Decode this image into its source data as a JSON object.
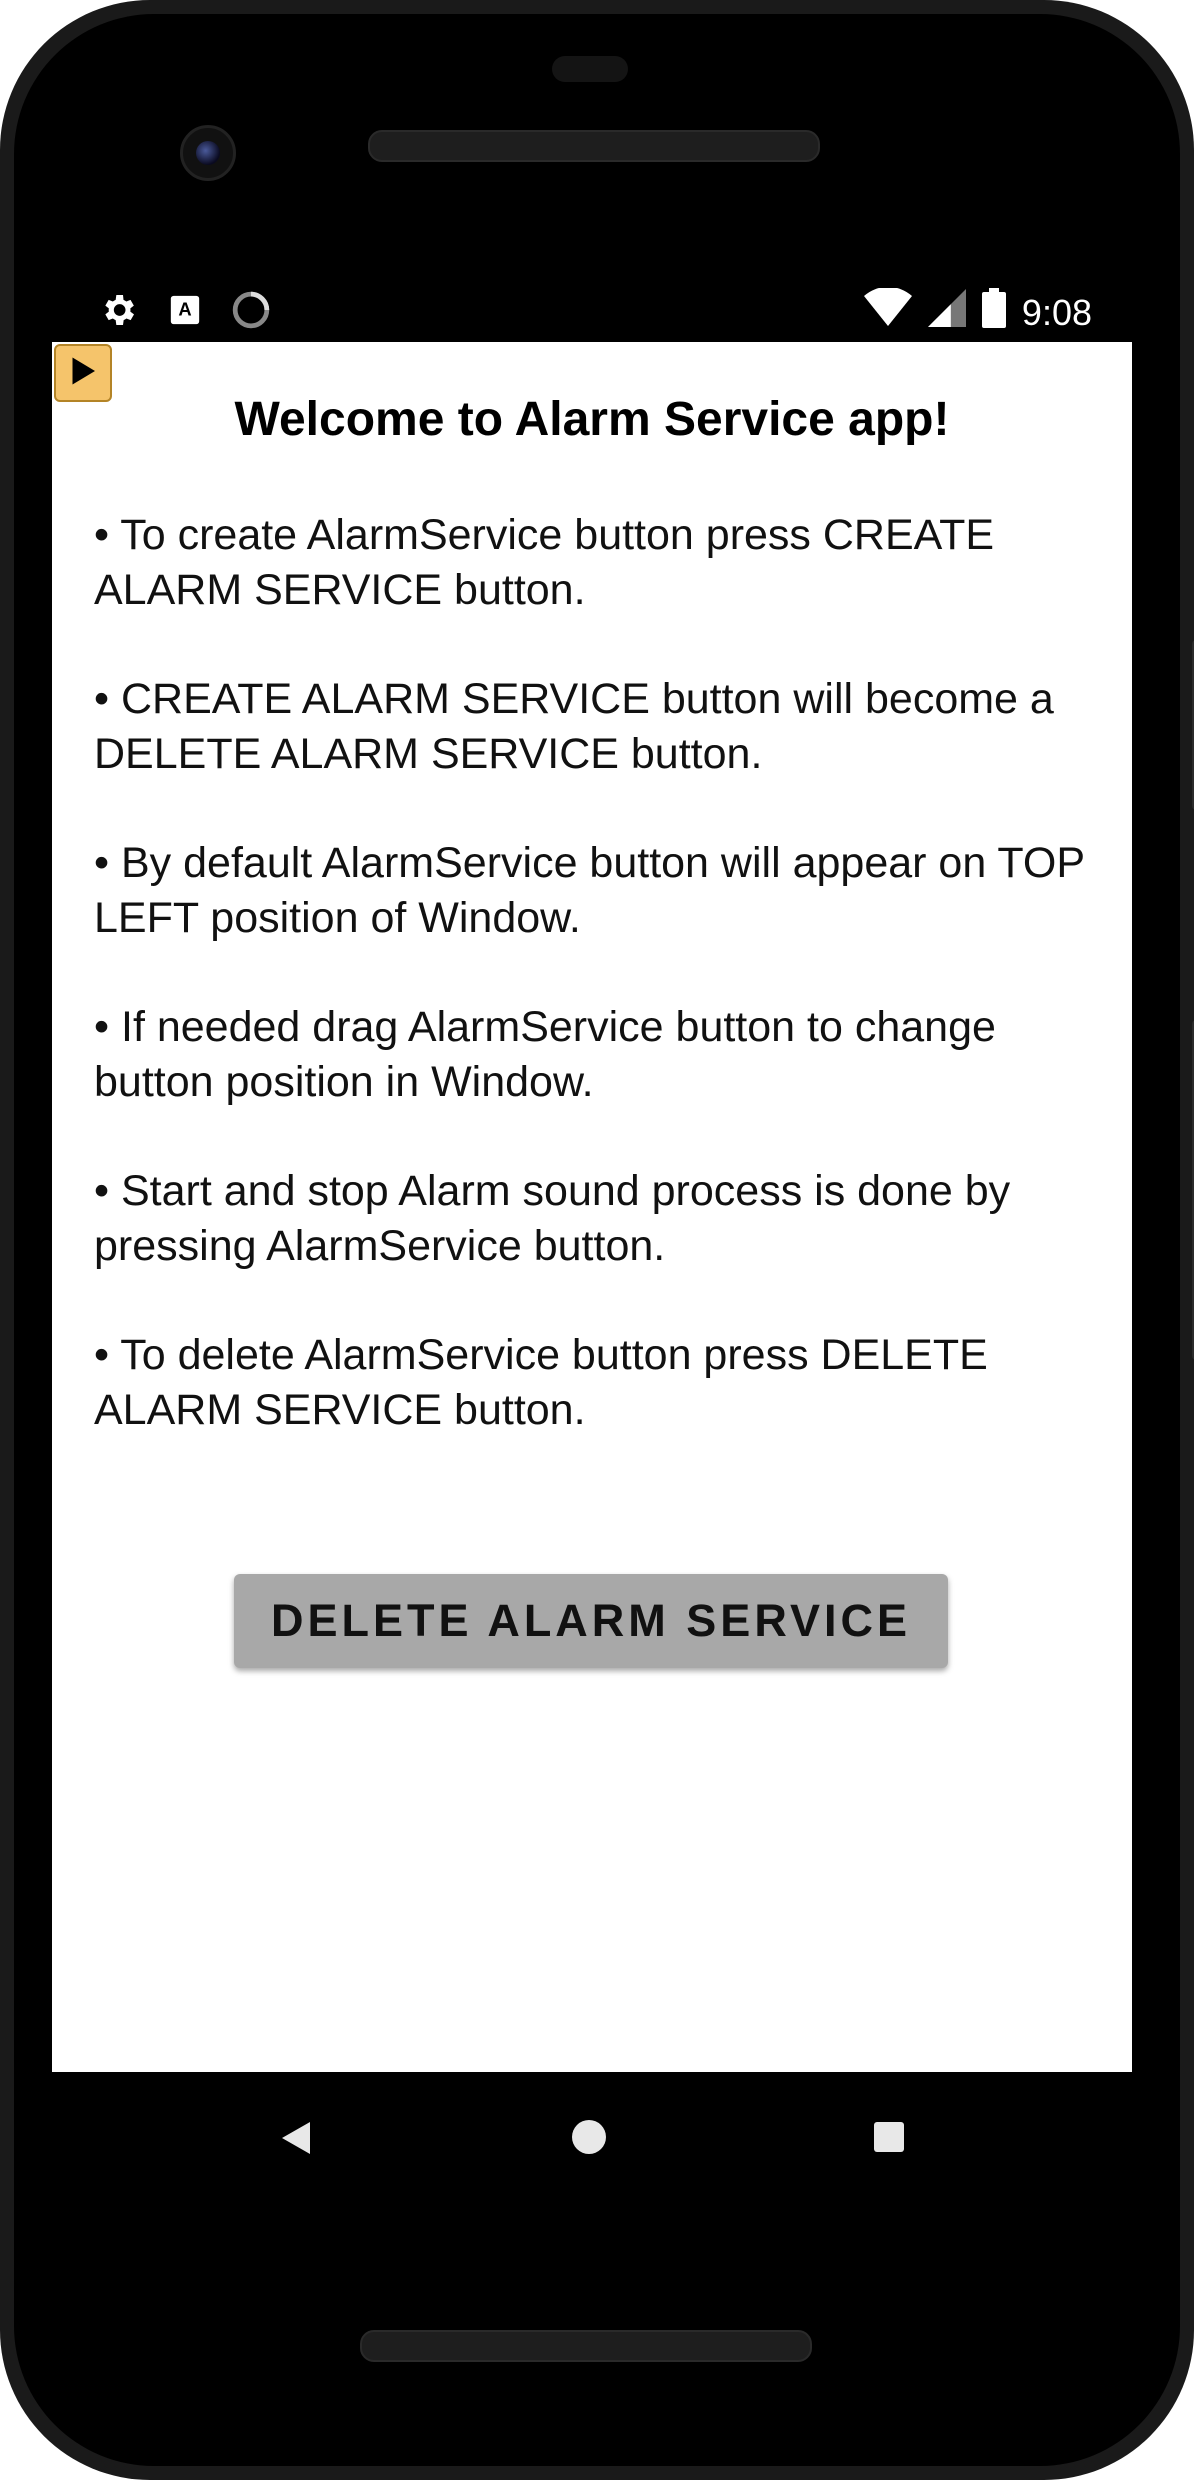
{
  "status_bar": {
    "time": "9:08",
    "left_icons": [
      "gear-icon",
      "text-a-icon",
      "loading-circle-icon"
    ],
    "right_icons": [
      "wifi-icon",
      "signal-icon",
      "battery-icon"
    ]
  },
  "floating_button": {
    "icon": "play-icon"
  },
  "content": {
    "title": "Welcome to Alarm Service app!",
    "bullets": [
      "• To create AlarmService button press CREATE ALARM SERVICE button.",
      " • CREATE ALARM SERVICE button will become a DELETE ALARM SERVICE button.",
      " • By default AlarmService button will appear on TOP LEFT position of Window.",
      " • If needed drag AlarmService button to change button position in Window.",
      " • Start and stop Alarm sound process is done by pressing AlarmService button.",
      " • To delete AlarmService button press DELETE ALARM SERVICE button."
    ],
    "delete_button_label": "DELETE ALARM SERVICE"
  },
  "nav_bar": {
    "icons": [
      "back-icon",
      "home-icon",
      "recents-icon"
    ]
  },
  "colors": {
    "floating_button_bg": "#f5c46b",
    "delete_button_bg": "#a8a8a8",
    "screen_bg": "#ffffff",
    "device_bg": "#000000"
  }
}
